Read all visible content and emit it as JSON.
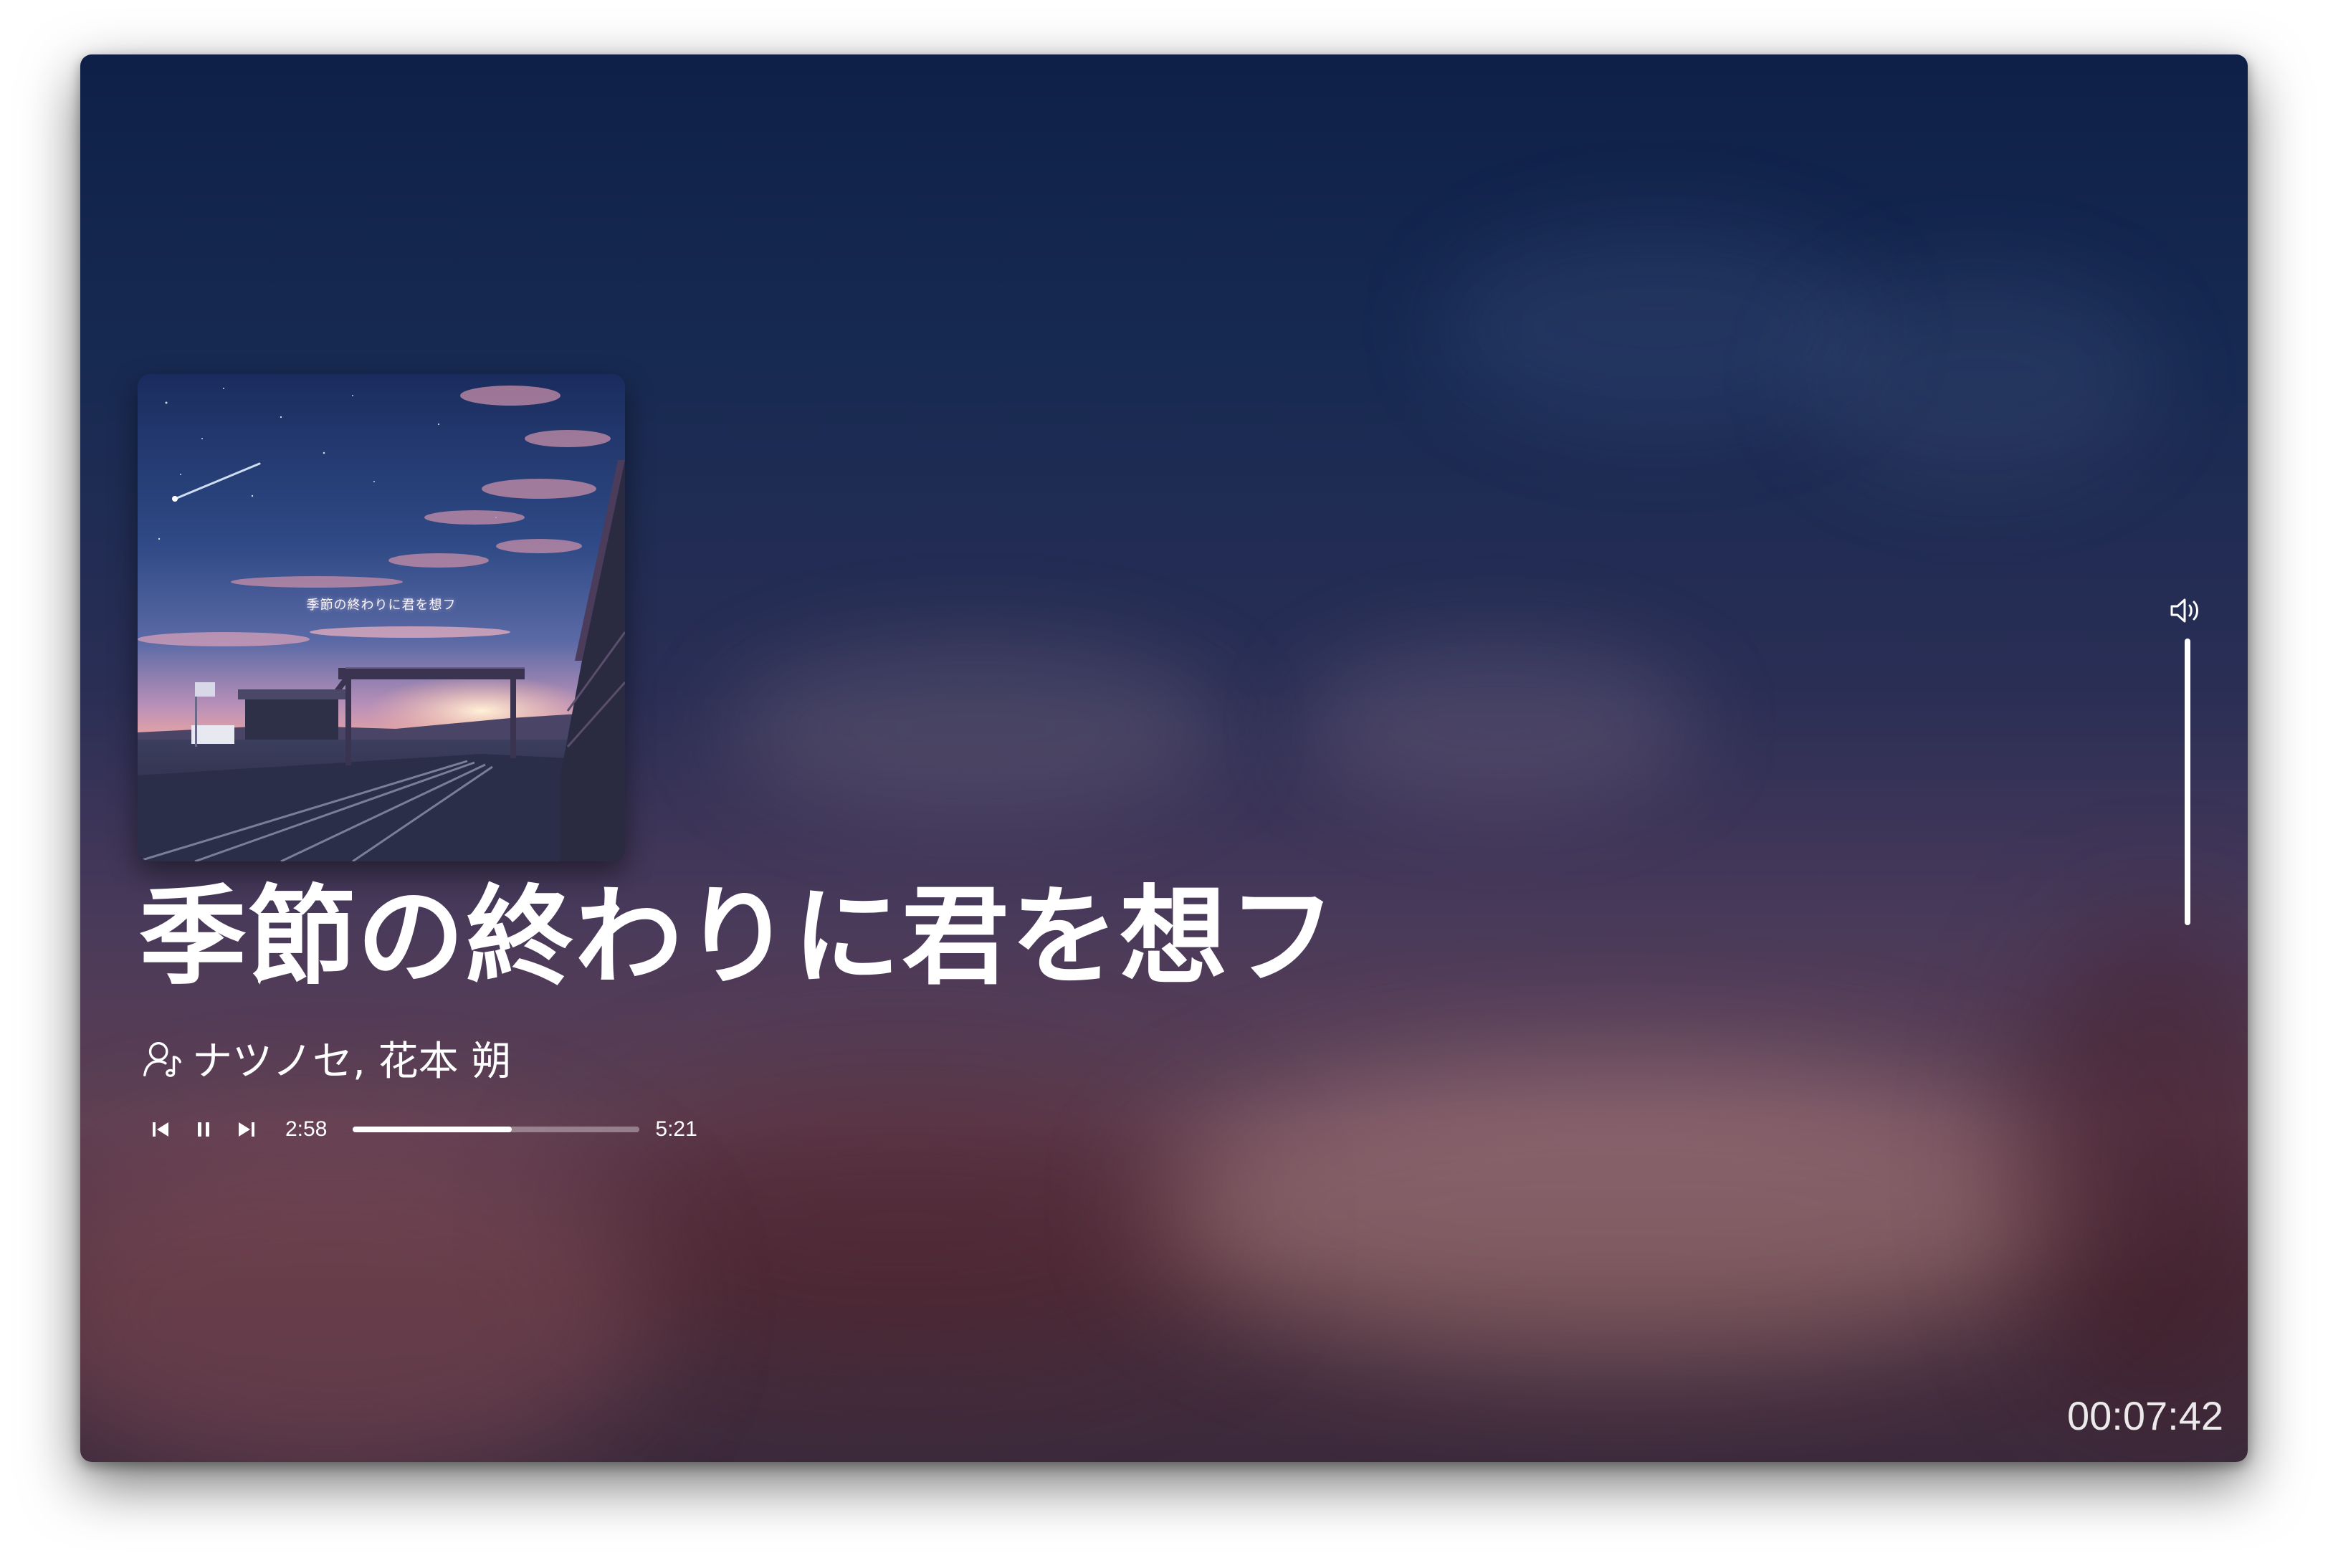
{
  "track": {
    "title": "季節の終わりに君を想フ",
    "artists": "ナツノセ, 花本 朔",
    "cover_title": "季節の終わりに君を想フ"
  },
  "playback": {
    "elapsed": "2:58",
    "duration": "5:21",
    "progress_fraction": 0.555,
    "state": "playing"
  },
  "volume": {
    "level_fraction": 1.0
  },
  "clock": {
    "time": "00:07:42"
  },
  "icons": {
    "previous": "previous-track-icon",
    "pause": "pause-icon",
    "next": "next-track-icon",
    "artist": "artist-music-note-icon",
    "volume": "speaker-volume-icon"
  },
  "colors": {
    "background_top": "#0e2047",
    "background_bottom": "#4a2e3c",
    "text": "#ffffff",
    "progress_track": "rgba(255,255,255,0.35)"
  }
}
